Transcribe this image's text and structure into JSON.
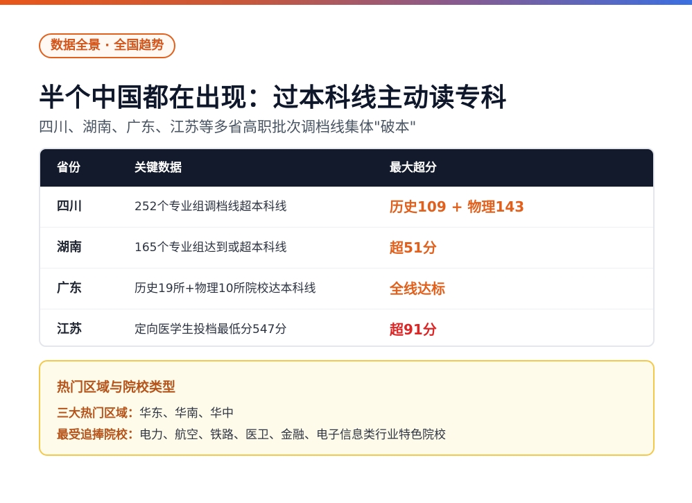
{
  "tag": "数据全景 · 全国趋势",
  "title": "半个中国都在出现：过本科线主动读专科",
  "subtitle": "四川、湖南、广东、江苏等多省高职批次调档线集体\"破本\"",
  "table": {
    "headers": [
      "省份",
      "关键数据",
      "最大超分"
    ],
    "rows": [
      {
        "province": "四川",
        "data": "252个专业组调档线超本科线",
        "max": "历史109 + 物理143",
        "color": "#e0601c"
      },
      {
        "province": "湖南",
        "data": "165个专业组达到或超本科线",
        "max": "超51分",
        "color": "#e0601c"
      },
      {
        "province": "广东",
        "data": "历史19所+物理10所院校达本科线",
        "max": "全线达标",
        "color": "#e0601c"
      },
      {
        "province": "江苏",
        "data": "定向医学生投档最低分547分",
        "max": "超91分",
        "color": "#dc2626"
      }
    ]
  },
  "info": {
    "title": "热门区域与院校类型",
    "lines": [
      {
        "label": "三大热门区域：",
        "value": "华东、华南、华中"
      },
      {
        "label": "最受追捧院校：",
        "value": "电力、航空、铁路、医卫、金融、电子信息类行业特色院校"
      }
    ]
  }
}
